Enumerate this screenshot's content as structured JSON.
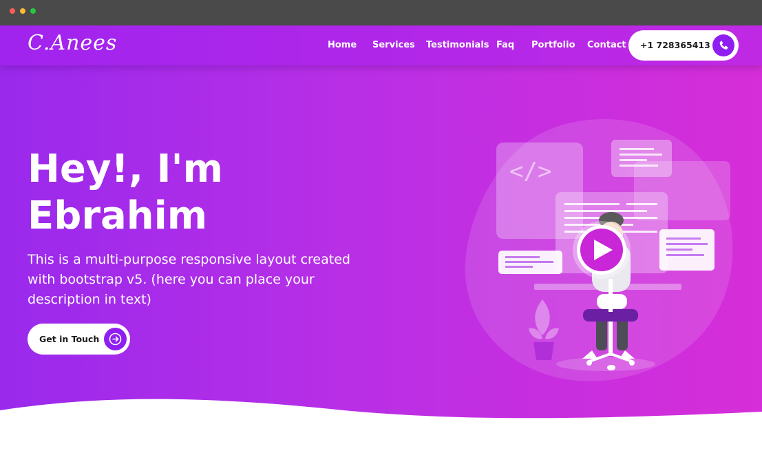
{
  "browser": {
    "window_controls": [
      "close",
      "minimize",
      "maximize"
    ]
  },
  "brand": {
    "logo_text": "C.Anees"
  },
  "nav": {
    "links": [
      {
        "label": "Home"
      },
      {
        "label": "Services"
      },
      {
        "label": "Testimonials"
      },
      {
        "label": "Faq"
      },
      {
        "label": "Portfolio"
      },
      {
        "label": "Contact"
      }
    ],
    "phone": {
      "number": "+1 728365413",
      "icon": "phone-icon"
    }
  },
  "hero": {
    "greeting_line1": "Hey!, I'm",
    "greeting_line2": "Ebrahim",
    "description": "This is a multi-purpose responsive layout created with bootstrap v5. (here you can place your description in text)",
    "cta": {
      "label": "Get in Touch",
      "icon": "arrow-right-icon"
    },
    "illustration": {
      "code_symbol": "</>",
      "play_icon": "play-icon"
    }
  },
  "colors": {
    "gradient_start": "#9a29ec",
    "gradient_end": "#d62ed8",
    "accent": "#8f1ef0",
    "white": "#ffffff"
  }
}
